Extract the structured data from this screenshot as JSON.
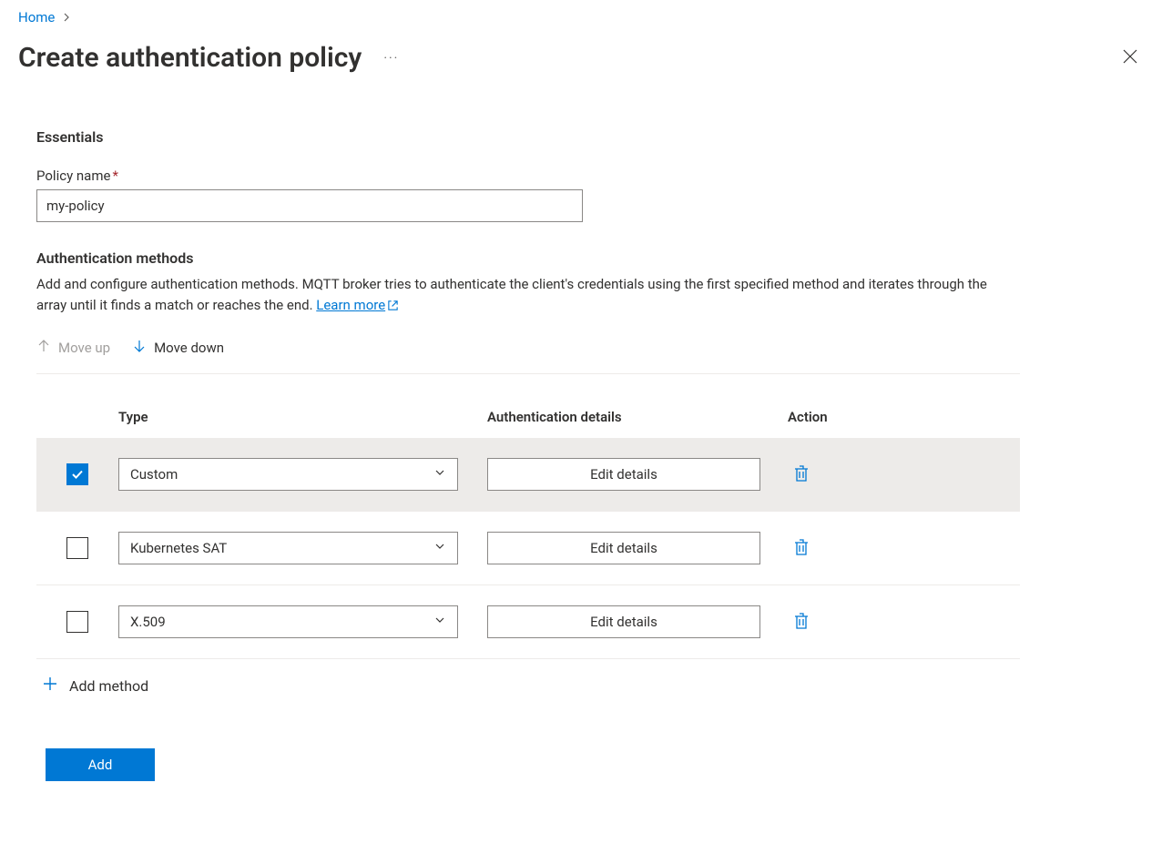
{
  "breadcrumb": {
    "home": "Home"
  },
  "page": {
    "title": "Create authentication policy"
  },
  "essentials": {
    "title": "Essentials",
    "policy_name_label": "Policy name",
    "policy_name_value": "my-policy"
  },
  "auth_methods": {
    "title": "Authentication methods",
    "description": "Add and configure authentication methods. MQTT broker tries to authenticate the client's credentials using the first specified method and iterates through the array until it finds a match or reaches the end. ",
    "learn_more": "Learn more"
  },
  "toolbar": {
    "move_up": "Move up",
    "move_down": "Move down"
  },
  "table": {
    "headers": {
      "type": "Type",
      "details": "Authentication details",
      "action": "Action"
    },
    "rows": [
      {
        "type": "Custom",
        "edit": "Edit details",
        "selected": true
      },
      {
        "type": "Kubernetes SAT",
        "edit": "Edit details",
        "selected": false
      },
      {
        "type": "X.509",
        "edit": "Edit details",
        "selected": false
      }
    ],
    "add_method": "Add method"
  },
  "footer": {
    "add": "Add"
  }
}
